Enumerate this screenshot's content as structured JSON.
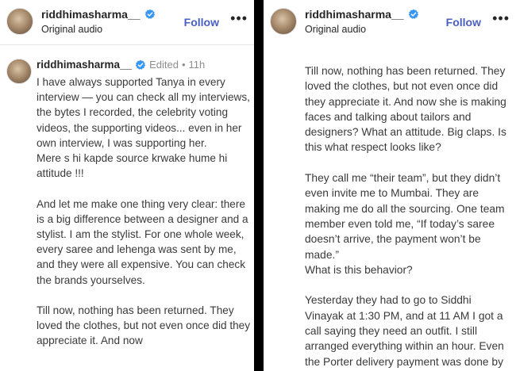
{
  "left": {
    "header": {
      "username": "riddhimasharma__",
      "subtitle": "Original audio",
      "follow_label": "Follow",
      "more_label": "•••"
    },
    "comment": {
      "username": "riddhimasharma__",
      "edited": "Edited",
      "dot": "•",
      "time": "11h",
      "text": "I have always supported Tanya in every interview — you can check all my interviews, the bytes I recorded, the celebrity voting videos, the supporting videos... even in her own interview, I was supporting her.\nMere s hi kapde source krwake hume hi attitude !!!\n\nAnd let me make one thing very clear: there is a big difference between a designer and a stylist. I am the stylist. For one whole week, every saree and lehenga was sent by me, and they were all expensive. You can check the brands yourselves.\n\nTill now, nothing has been returned. They loved the clothes, but not even once did they appreciate it. And now"
    }
  },
  "right": {
    "header": {
      "username": "riddhimasharma__",
      "subtitle": "Original audio",
      "follow_label": "Follow",
      "more_label": "•••"
    },
    "text": "Till now, nothing has been returned. They loved the clothes, but not even once did they appreciate it. And now she is making faces and talking about tailors and designers? What an attitude. Big claps. Is this what respect looks like?\n\nThey call me “their team”, but they didn’t even invite me to Mumbai. They are making me do all the sourcing. One team member even told me, “If today’s saree doesn’t arrive, the payment won’t be made.”\nWhat is this behavior?\n\nYesterday they had to go to Siddhi Vinayak at 1:30 PM, and at 11 AM I got a call saying they need an outfit. I still arranged everything within an hour. Even the Porter delivery payment was done by me."
  },
  "colors": {
    "follow": "#4a5fc1",
    "verified": "#3897f0",
    "divider": "#000000"
  },
  "icons": [
    "verified-badge-icon",
    "more-options-icon"
  ]
}
